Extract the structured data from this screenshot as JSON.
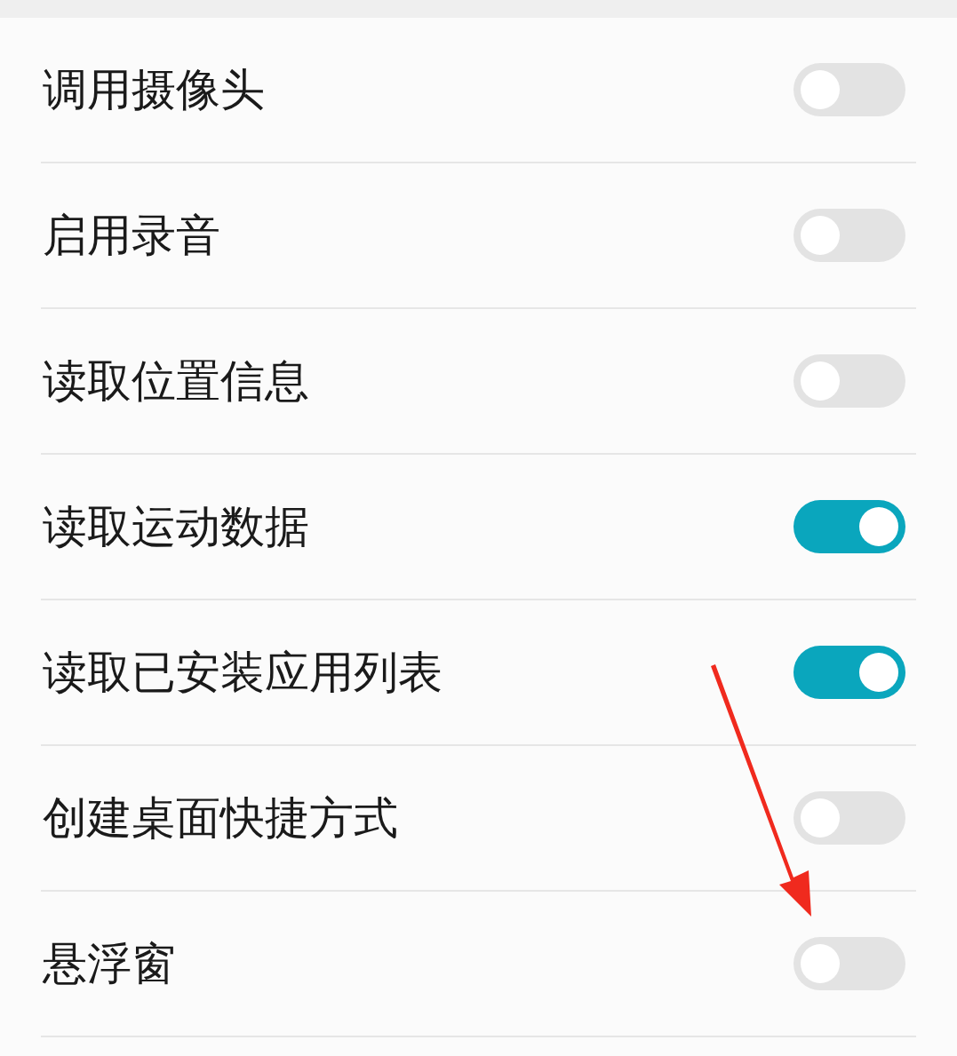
{
  "permissions": [
    {
      "label": "调用摄像头",
      "on": false
    },
    {
      "label": "启用录音",
      "on": false
    },
    {
      "label": "读取位置信息",
      "on": false
    },
    {
      "label": "读取运动数据",
      "on": true
    },
    {
      "label": "读取已安装应用列表",
      "on": true
    },
    {
      "label": "创建桌面快捷方式",
      "on": false
    },
    {
      "label": "悬浮窗",
      "on": false
    }
  ]
}
